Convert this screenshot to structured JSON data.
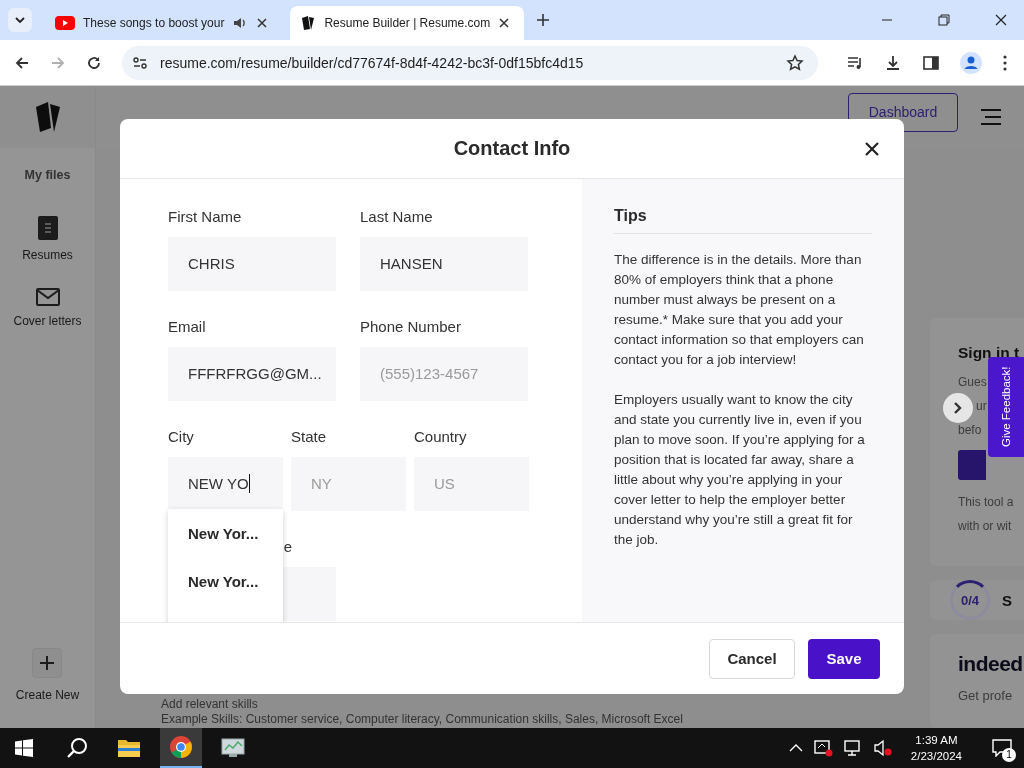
{
  "browser": {
    "tabs": [
      {
        "title": "These songs to boost your",
        "selected": false,
        "audio_playing": true,
        "kind": "video"
      },
      {
        "title": "Resume Builder | Resume.com",
        "selected": true,
        "audio_playing": false,
        "kind": "site"
      }
    ],
    "forward_disabled": true,
    "url": "resume.com/resume/builder/cd77674f-8d4f-4242-bc3f-0df15bfc4d15"
  },
  "sidebar": {
    "heading": "My files",
    "items": [
      {
        "label": "Resumes",
        "kind": "document"
      },
      {
        "label": "Cover letters",
        "kind": "envelope"
      }
    ],
    "create_label": "Create New"
  },
  "header": {
    "dashboard_button": "Dashboard"
  },
  "background": {
    "skills_title": "Add relevant skills",
    "skills_example": "Example Skills: Customer service, Computer literacy, Communication skills, Sales, Microsoft Excel",
    "sign_in": {
      "title": "Sign in t",
      "lines": [
        "Gues",
        "ur",
        "befo"
      ],
      "note_lines": [
        "This tool a",
        "with or wit"
      ]
    },
    "progress": {
      "count": "0/4",
      "label": "S"
    },
    "indeed": {
      "logo": "indeed",
      "text": "Get profe"
    },
    "feedback_tab": "Give Feedback!"
  },
  "modal": {
    "title": "Contact Info",
    "rows": [
      [
        {
          "label": "First Name",
          "value": "CHRIS",
          "focused": false
        },
        {
          "label": "Last Name",
          "value": "HANSEN",
          "focused": false
        }
      ],
      [
        {
          "label": "Email",
          "value": "FFFRFRGG@GM...",
          "focused": false
        },
        {
          "label": "Phone Number",
          "placeholder": "(555)123-4567",
          "focused": false
        }
      ],
      [
        {
          "label": "City",
          "value": "NEW YO",
          "focused": true
        },
        {
          "label": "State",
          "placeholder": "NY",
          "focused": false
        },
        {
          "label": "Country",
          "placeholder": "US",
          "focused": false
        }
      ],
      [
        {
          "label": "e",
          "focused": false
        }
      ]
    ],
    "suggestions": [
      "New Yor...",
      "New Yor..."
    ],
    "tips": {
      "title": "Tips",
      "paragraphs": [
        "The difference is in the details. More than 80% of employers think that a phone number must always be present on a resume.* Make sure that you add your contact information so that employers can contact you for a job interview!",
        "Employers usually want to know the city and state you currently live in, even if you plan to move soon. If you’re applying for a position that is located far away, share a little about why you’re applying in your cover letter to help the employer better understand why you’re still a great fit for the job."
      ]
    },
    "buttons": [
      {
        "label": "Cancel",
        "kind": "secondary"
      },
      {
        "label": "Save",
        "kind": "primary"
      }
    ]
  },
  "taskbar": {
    "apps": [
      {
        "kind": "search",
        "active": false
      },
      {
        "kind": "folder",
        "active": false
      },
      {
        "kind": "chrome",
        "active": true
      },
      {
        "kind": "monitor",
        "active": false
      }
    ],
    "time": "1:39 AM",
    "date": "2/23/2024",
    "notifications": "1"
  }
}
